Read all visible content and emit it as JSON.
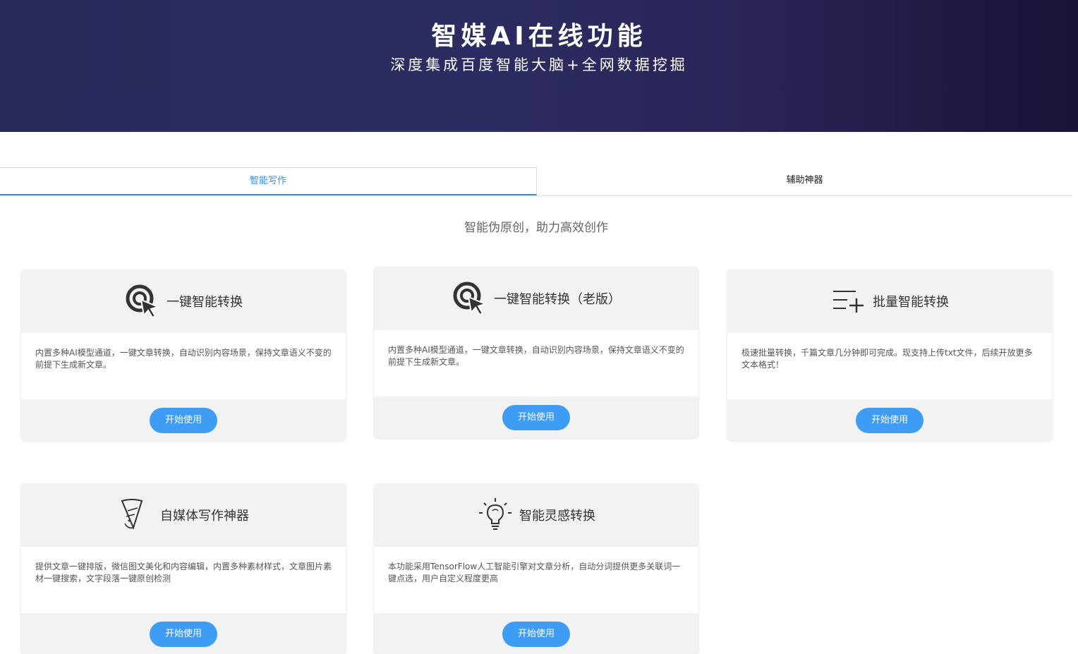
{
  "hero": {
    "title": "智媒AI在线功能",
    "subtitle": "深度集成百度智能大脑+全网数据挖掘"
  },
  "tabs": [
    {
      "label": "智能写作",
      "active": true
    },
    {
      "label": "辅助神器",
      "active": false
    }
  ],
  "section": {
    "subtitle": "智能伪原创，助力高效创作"
  },
  "cards": [
    {
      "title": "一键智能转换",
      "icon": "click-cursor-icon",
      "description": "内置多种AI模型通道，一键文章转换，自动识别内容场景，保持文章语义不变的前提下生成新文章。",
      "button": "开始使用"
    },
    {
      "title": "一键智能转换（老版）",
      "icon": "click-cursor-icon",
      "description": "内置多种AI模型通道，一键文章转换，自动识别内容场景，保持文章语义不变的前提下生成新文章。",
      "button": "开始使用"
    },
    {
      "title": "批量智能转换",
      "icon": "batch-list-add-icon",
      "description": "极速批量转换，千篇文章几分钟即可完成。现支持上传txt文件，后续开放更多文本格式！",
      "button": "开始使用"
    },
    {
      "title": "自媒体写作神器",
      "icon": "writing-pen-icon",
      "description": "提供文章一键排版，微信图文美化和内容编辑，内置多种素材样式，文章图片素材一键搜索，文字段落一键原创检测",
      "button": "开始使用"
    },
    {
      "title": "智能灵感转换",
      "icon": "lightbulb-icon",
      "description": "本功能采用TensorFlow人工智能引擎对文章分析，自动分词提供更多关联词一键点选，用户自定义程度更高",
      "button": "开始使用"
    }
  ],
  "colors": {
    "accent": "#3f9cf5",
    "tab_active": "#3a8ee6",
    "hero_bg": "#2a2a5a"
  }
}
